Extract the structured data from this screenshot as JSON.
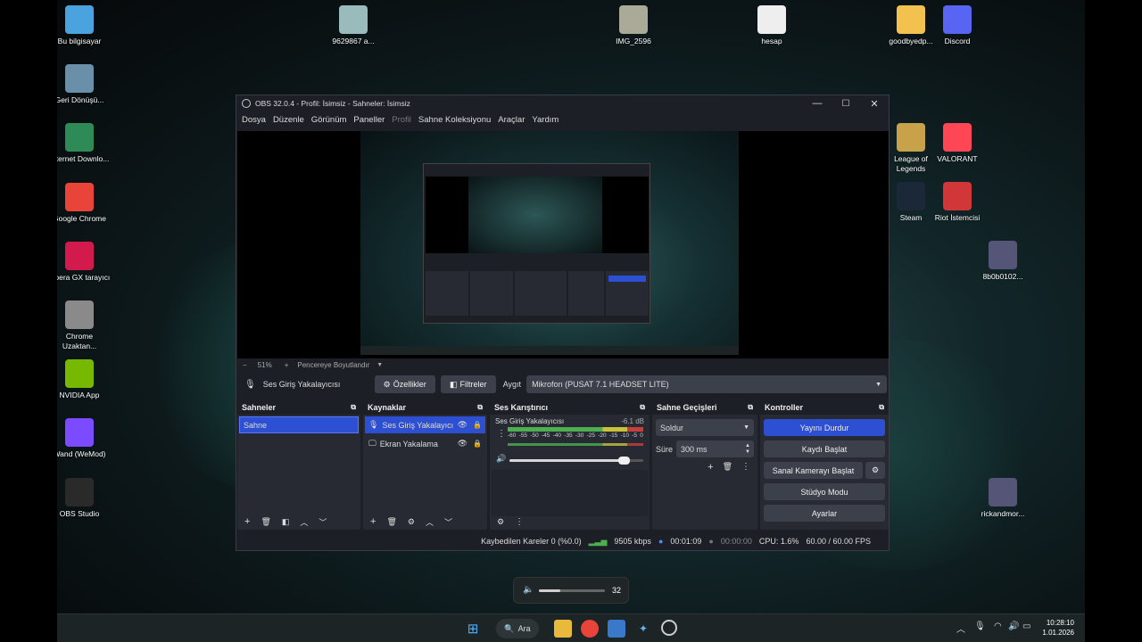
{
  "desktop": {
    "left_icons": [
      {
        "label": "Bu bilgisayar",
        "icon": "monitor-icon",
        "color": "#4aa3df"
      },
      {
        "label": "Geri Dönüşü...",
        "icon": "recycle-bin-icon",
        "color": "#6a8fa8"
      },
      {
        "label": "Internet Downlo...",
        "icon": "idm-icon",
        "color": "#2e8b57"
      },
      {
        "label": "Google Chrome",
        "icon": "chrome-icon",
        "color": "#e8443a"
      },
      {
        "label": "Opera GX tarayıcı",
        "icon": "opera-gx-icon",
        "color": "#d21a4c"
      },
      {
        "label": "Chrome Uzaktan...",
        "icon": "chrome-remote-icon",
        "color": "#8a8a8a"
      },
      {
        "label": "NVIDIA App",
        "icon": "nvidia-icon",
        "color": "#76b900"
      },
      {
        "label": "Wand (WeMod)",
        "icon": "wand-icon",
        "color": "#7b4cff"
      },
      {
        "label": "OBS Studio",
        "icon": "obs-icon",
        "color": "#2a2a2a"
      }
    ],
    "top_icons": [
      {
        "label": "9629867 a...",
        "icon": "image-file-icon",
        "color": "#9bb"
      },
      {
        "label": "IMG_2596",
        "icon": "image-file-icon",
        "color": "#aa9"
      },
      {
        "label": "hesap",
        "icon": "text-file-icon",
        "color": "#eee"
      },
      {
        "label": "goodbyedp...",
        "icon": "folder-icon",
        "color": "#f2c14e"
      },
      {
        "label": "Discord",
        "icon": "discord-icon",
        "color": "#5865f2"
      }
    ],
    "right_icons": [
      {
        "label": "League of Legends",
        "icon": "league-icon",
        "color": "#c8a24a"
      },
      {
        "label": "VALORANT",
        "icon": "valorant-icon",
        "color": "#ff4655"
      },
      {
        "label": "Steam",
        "icon": "steam-icon",
        "color": "#1b2838"
      },
      {
        "label": "Riot İstemcisi",
        "icon": "riot-icon",
        "color": "#d13639"
      },
      {
        "label": "8b0b0102...",
        "icon": "image-file-icon",
        "color": "#557"
      },
      {
        "label": "rickandmor...",
        "icon": "image-file-icon",
        "color": "#557"
      }
    ]
  },
  "obs": {
    "title": "OBS 32.0.4 - Profil: İsimsiz - Sahneler: İsimsiz",
    "menu": [
      "Dosya",
      "Düzenle",
      "Görünüm",
      "Paneller",
      "Profil",
      "Sahne Koleksiyonu",
      "Araçlar",
      "Yardım"
    ],
    "zoom": {
      "minus": "−",
      "value": "51%",
      "plus": "+",
      "fit": "Pencereye Boyutlandır"
    },
    "source_bar": {
      "source_name": "Ses Giriş Yakalayıcısı",
      "properties": "Özellikler",
      "filters": "Filtreler",
      "device_label": "Aygıt",
      "device_value": "Mikrofon (PUSAT 7.1 HEADSET LITE)"
    },
    "scenes": {
      "title": "Sahneler",
      "items": [
        "Sahne"
      ]
    },
    "sources": {
      "title": "Kaynaklar",
      "items": [
        "Ses Giriş Yakalayıcı",
        "Ekran Yakalama"
      ]
    },
    "mixer": {
      "title": "Ses Karıştırıcı",
      "channel": "Ses Giriş Yakalayıcısı",
      "db": "-6.1 dB",
      "scale": [
        "-60",
        "-55",
        "-50",
        "-45",
        "-40",
        "-35",
        "-30",
        "-25",
        "-20",
        "-15",
        "-10",
        "-5",
        "0"
      ],
      "volume_fraction": 0.85
    },
    "transitions": {
      "title": "Sahne Geçişleri",
      "selected": "Soldur",
      "duration_label": "Süre",
      "duration_value": "300 ms"
    },
    "controls": {
      "title": "Kontroller",
      "stop_stream": "Yayını Durdur",
      "start_record": "Kaydı Başlat",
      "virtual_cam": "Sanal Kamerayı Başlat",
      "studio_mode": "Stüdyo Modu",
      "settings": "Ayarlar",
      "accent": "#2d4fd1"
    },
    "status": {
      "dropped": "Kaybedilen Kareler 0 (%0.0)",
      "bitrate": "9505 kbps",
      "stream_time": "00:01:09",
      "rec_time": "00:00:00",
      "cpu": "CPU: 1.6%",
      "fps": "60.00 / 60.00 FPS"
    }
  },
  "volume_osd": {
    "value": "32",
    "fraction": 0.32
  },
  "taskbar": {
    "search": "Ara",
    "time": "10:28:10",
    "date": "1.01.2026"
  }
}
